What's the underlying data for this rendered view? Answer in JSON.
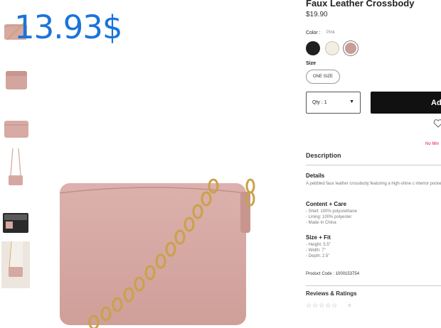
{
  "product": {
    "title": "Faux Leather Crossbody",
    "price": "$19.90",
    "overlay_price": "13.93$"
  },
  "options": {
    "color_label": "Color :",
    "color_value": "Pink",
    "swatches": [
      {
        "name": "black",
        "color": "#1f1f1f"
      },
      {
        "name": "cream",
        "color": "#f3eee4"
      },
      {
        "name": "pink",
        "color": "#c99c98"
      }
    ],
    "size_label": "Size",
    "size_value": "ONE SIZE"
  },
  "purchase": {
    "qty_label": "Qty : 1",
    "qty_arrow": "▼",
    "add_label": "Ad"
  },
  "wishlist_icon": "heart-icon",
  "notice_text": "No Min",
  "description": {
    "heading": "Description",
    "details_title": "Details",
    "details_text": "A pebbled faux leather crossbody featuring a high-shine c interior pocket.",
    "content_title": "Content + Care",
    "content_lines": [
      "- Shell: 100% polyurethane",
      "- Lining: 100% polyester",
      "- Made In China"
    ],
    "fit_title": "Size + Fit",
    "fit_lines": [
      "- Height: 5.5\"",
      "- Width: 7\"",
      "- Depth: 2.5\""
    ],
    "product_code": "Product Code : 1000153754"
  },
  "reviews": {
    "heading": "Reviews & Ratings",
    "stars": "☆☆☆☆☆",
    "count": "0"
  },
  "colors": {
    "accent_overlay": "#1a74d9",
    "bag_pink": "#d8aaa5",
    "chain_gold": "#c9a24a"
  }
}
